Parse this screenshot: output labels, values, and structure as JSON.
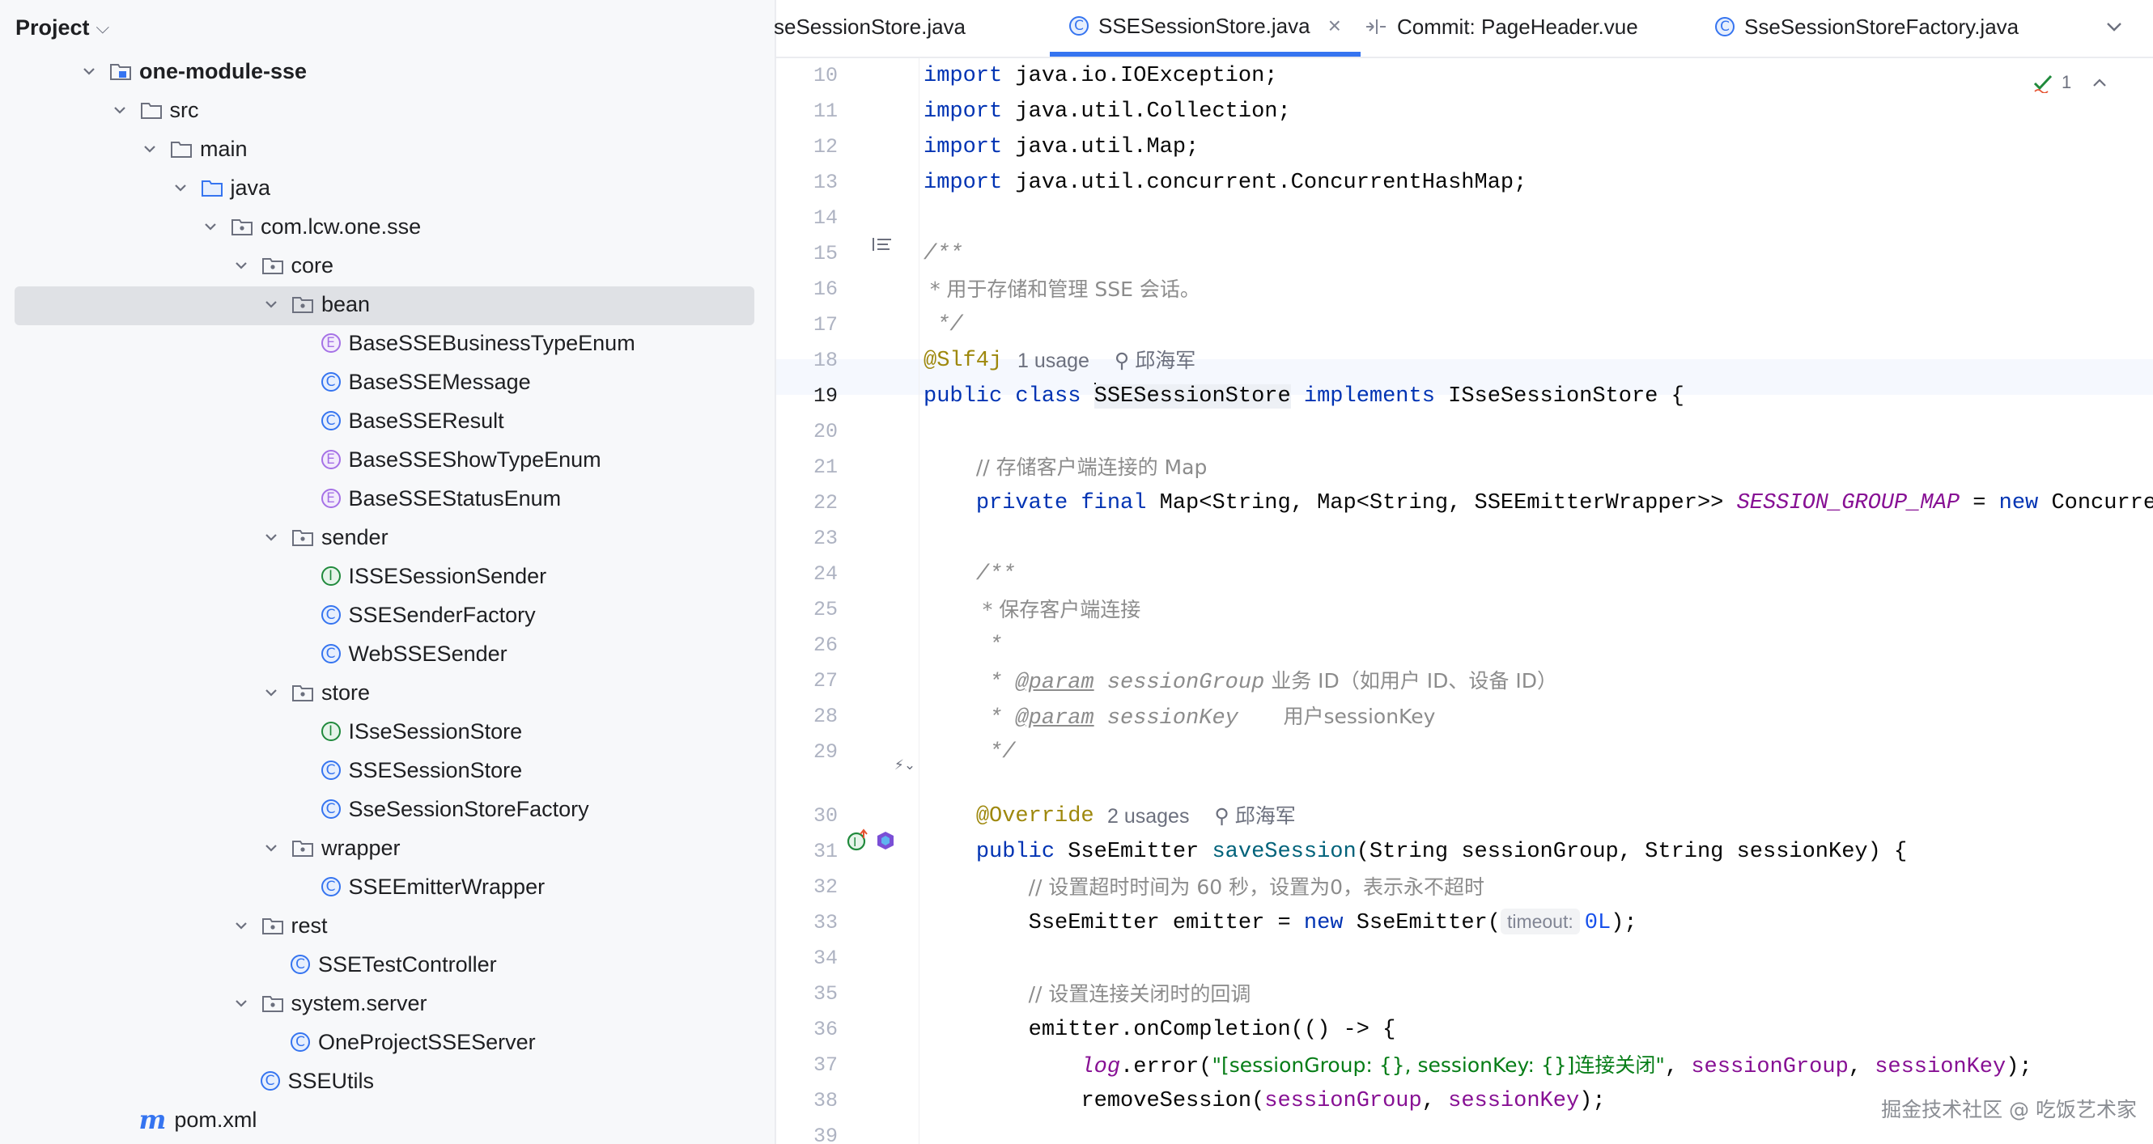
{
  "project_panel": {
    "title": "Project",
    "tree": [
      {
        "label": "one-module-sse",
        "kind": "module",
        "depth": 0,
        "expanded": true,
        "bold": true
      },
      {
        "label": "src",
        "kind": "folder",
        "depth": 1,
        "expanded": true
      },
      {
        "label": "main",
        "kind": "folder",
        "depth": 2,
        "expanded": true
      },
      {
        "label": "java",
        "kind": "source-root",
        "depth": 3,
        "expanded": true
      },
      {
        "label": "com.lcw.one.sse",
        "kind": "package",
        "depth": 4,
        "expanded": true
      },
      {
        "label": "core",
        "kind": "package",
        "depth": 5,
        "expanded": true
      },
      {
        "label": "bean",
        "kind": "package",
        "depth": 6,
        "expanded": true,
        "selected": true
      },
      {
        "label": "BaseSSEBusinessTypeEnum",
        "kind": "enum",
        "depth": 7
      },
      {
        "label": "BaseSSEMessage",
        "kind": "class",
        "depth": 7
      },
      {
        "label": "BaseSSEResult",
        "kind": "class",
        "depth": 7
      },
      {
        "label": "BaseSSEShowTypeEnum",
        "kind": "enum",
        "depth": 7
      },
      {
        "label": "BaseSSEStatusEnum",
        "kind": "enum",
        "depth": 7
      },
      {
        "label": "sender",
        "kind": "package",
        "depth": 6,
        "expanded": true
      },
      {
        "label": "ISSESessionSender",
        "kind": "interface",
        "depth": 7
      },
      {
        "label": "SSESenderFactory",
        "kind": "class",
        "depth": 7
      },
      {
        "label": "WebSSESender",
        "kind": "class",
        "depth": 7
      },
      {
        "label": "store",
        "kind": "package",
        "depth": 6,
        "expanded": true
      },
      {
        "label": "ISseSessionStore",
        "kind": "interface",
        "depth": 7
      },
      {
        "label": "SSESessionStore",
        "kind": "class",
        "depth": 7
      },
      {
        "label": "SseSessionStoreFactory",
        "kind": "class",
        "depth": 7
      },
      {
        "label": "wrapper",
        "kind": "package",
        "depth": 6,
        "expanded": true
      },
      {
        "label": "SSEEmitterWrapper",
        "kind": "class",
        "depth": 7
      },
      {
        "label": "rest",
        "kind": "package",
        "depth": 5,
        "expanded": true
      },
      {
        "label": "SSETestController",
        "kind": "class",
        "depth": 6
      },
      {
        "label": "system.server",
        "kind": "package",
        "depth": 5,
        "expanded": true
      },
      {
        "label": "OneProjectSSEServer",
        "kind": "class",
        "depth": 6
      },
      {
        "label": "SSEUtils",
        "kind": "class",
        "depth": 5
      },
      {
        "label": "pom.xml",
        "kind": "maven",
        "depth": 1
      }
    ]
  },
  "tabs": [
    {
      "label": "seSessionStore.java",
      "icon": "none"
    },
    {
      "label": "SSESessionStore.java",
      "icon": "class",
      "active": true
    },
    {
      "label": "Commit: PageHeader.vue",
      "icon": "commit"
    },
    {
      "label": "SseSessionStoreFactory.java",
      "icon": "class"
    }
  ],
  "editor": {
    "current_line": "19",
    "inspection_count": "1",
    "line_numbers": [
      "10",
      "11",
      "12",
      "13",
      "14",
      "15",
      "16",
      "17",
      "18",
      "19",
      "20",
      "21",
      "22",
      "23",
      "24",
      "25",
      "26",
      "27",
      "28",
      "29",
      "",
      "30",
      "31",
      "32",
      "33",
      "34",
      "35",
      "36",
      "37",
      "38",
      "39"
    ],
    "inlays": {
      "usage_1": "1 usage",
      "author_1": "邱海军",
      "usage_2": "2 usages",
      "author_2": "邱海军"
    },
    "tokens": {
      "import": "import",
      "imp10": " java.io.IOException;",
      "imp11": " java.util.Collection;",
      "imp12": " java.util.Map;",
      "imp13": " java.util.concurrent.ConcurrentHashMap;",
      "doc_open": "/**",
      "doc16": " * 用于存储和管理 SSE 会话。",
      "doc_close": " */",
      "slf4j": "@Slf4j",
      "public": "public",
      "class": "class",
      "class_name": "SSESessionStore",
      "implements": "implements",
      "iface": " ISseSessionStore {",
      "c21": "// 存储客户端连接的 Map",
      "private": "private",
      "final": "final",
      "t22": " Map<String, Map<String, SSEEmitterWrapper>> ",
      "const22": "SESSION_GROUP_MAP",
      "eq": " = ",
      "new": "new",
      "t22b": " ConcurrentHashMap<>();",
      "d24": "/**",
      "d25": " * 保存客户端连接",
      "d26": " *",
      "star": " * ",
      "param": "@param",
      "p27": " sessionGroup",
      "d27": " 业务 ID（如用户 ID、设备 ID）",
      "p28": " sessionKey",
      "d28": "       用户sessionKey",
      "d29": " */",
      "override": "@Override",
      "t31a": " SseEmitter ",
      "save": "saveSession",
      "t31b": "(String sessionGroup, String sessionKey) {",
      "c32": "// 设置超时时间为 60 秒，设置为0，表示永不超时",
      "t33a": "SseEmitter emitter = ",
      "t33b": " SseEmitter(",
      "hint33": "timeout:",
      "num33": "0L",
      "t33c": ");",
      "c35": "// 设置连接关闭时的回调",
      "t36": "emitter.onCompletion(() -> {",
      "log": "log",
      "t37a": ".error(",
      "s37": "\"[sessionGroup: {}, sessionKey: {}]连接关闭\"",
      "comma": ", ",
      "sg": "sessionGroup",
      "sk": "sessionKey",
      "t37b": ");",
      "t38a": "removeSession(",
      "t38b": ");"
    }
  },
  "watermark": "掘金技术社区 @ 吃饭艺术家",
  "colors": {
    "accent": "#3574f0",
    "keyword": "#0033b3",
    "annotation": "#9e880d",
    "comment": "#8c8c8c",
    "field": "#871094",
    "string": "#067d17"
  }
}
